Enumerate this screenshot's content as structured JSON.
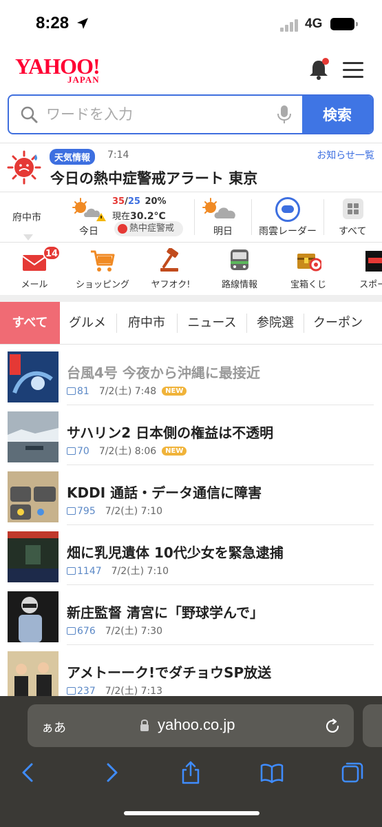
{
  "status_bar": {
    "time": "8:28",
    "network": "4G"
  },
  "header": {
    "logo_main": "YAHOO!",
    "logo_sub": "JAPAN"
  },
  "search": {
    "placeholder": "ワードを入力",
    "button_label": "検索"
  },
  "weather_alert": {
    "badge": "天気情報",
    "time": "7:14",
    "more_link": "お知らせ一覧",
    "title": "今日の熱中症警戒アラート 東京"
  },
  "weather": {
    "city": "府中市",
    "today_label": "今日",
    "high": "35",
    "slash": "/",
    "low": "25",
    "rain": "20%",
    "now_prefix": "現在",
    "now_temp": "30.2°C",
    "heat_badge": "熱中症警戒",
    "tomorrow_label": "明日",
    "radar_label": "雨雲レーダー",
    "all_label": "すべて"
  },
  "services": [
    {
      "label": "メール",
      "icon": "mail-icon",
      "badge": "14"
    },
    {
      "label": "ショッピング",
      "icon": "shopping-cart-icon"
    },
    {
      "label": "ヤフオク!",
      "icon": "auction-hammer-icon"
    },
    {
      "label": "路線情報",
      "icon": "train-icon"
    },
    {
      "label": "宝箱くじ",
      "icon": "treasure-box-icon"
    },
    {
      "label": "スポーツ",
      "icon": "sports-icon"
    }
  ],
  "tabs": [
    "すべて",
    "グルメ",
    "府中市",
    "ニュース",
    "参院選",
    "クーポン"
  ],
  "news": [
    {
      "title": "台風4号 今夜から沖縄に最接近",
      "comments": "81",
      "date": "7/2(土) 7:48",
      "badge": "NEW",
      "read": true
    },
    {
      "title": "サハリン2 日本側の権益は不透明",
      "comments": "70",
      "date": "7/2(土) 8:06",
      "badge": "NEW",
      "read": false
    },
    {
      "title": "KDDI 通話・データ通信に障害",
      "comments": "795",
      "date": "7/2(土) 7:10",
      "badge": "",
      "read": false
    },
    {
      "title": "畑に乳児遺体 10代少女を緊急逮捕",
      "comments": "1147",
      "date": "7/2(土) 7:10",
      "badge": "",
      "read": false
    },
    {
      "title": "新庄監督 清宮に「野球学んで」",
      "comments": "676",
      "date": "7/2(土) 7:30",
      "badge": "",
      "read": false
    },
    {
      "title": "アメトーーク!でダチョウSP放送",
      "comments": "237",
      "date": "7/2(土) 7:13",
      "badge": "",
      "read": false
    }
  ],
  "browser": {
    "text_size": "ぁあ",
    "url": "yahoo.co.jp"
  },
  "colors": {
    "brand": "#ff0033",
    "accent": "#3f75e4",
    "tab_active": "#f06b74",
    "new_badge": "#f0b33a"
  }
}
